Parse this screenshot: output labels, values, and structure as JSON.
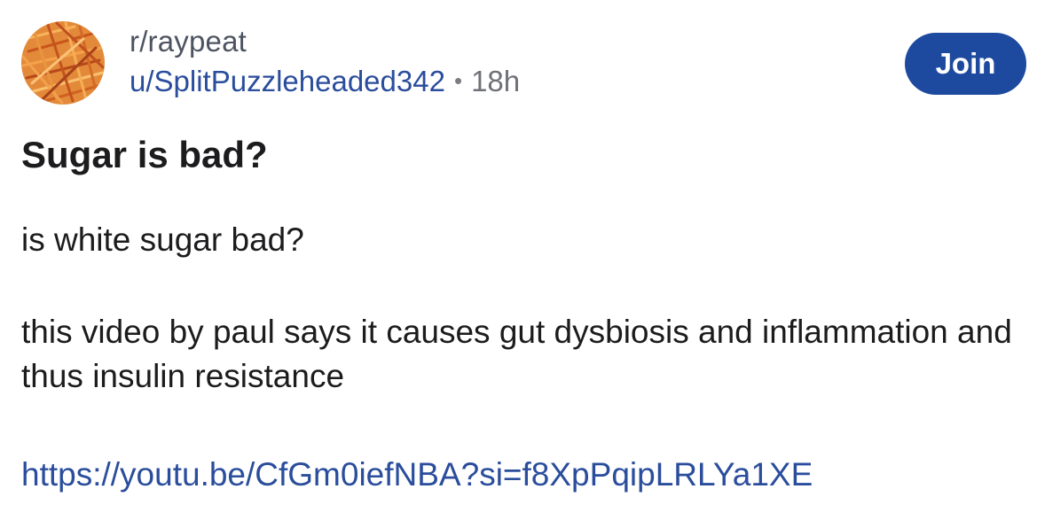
{
  "post": {
    "subreddit": "r/raypeat",
    "username": "u/SplitPuzzleheaded342",
    "separator": "•",
    "time": "18h",
    "join_label": "Join",
    "title": "Sugar is bad?",
    "body": [
      "is white sugar bad?",
      "this video by paul says it causes gut dysbiosis and inflammation and thus insulin resistance"
    ],
    "link": "https://youtu.be/CfGm0iefNBA?si=f8XpPqipLRLYa1XE"
  },
  "colors": {
    "join_button": "#1d4a9e",
    "link": "#2a4d9c",
    "avatar_base": "#d9782a"
  },
  "icons": {
    "avatar": "subreddit-avatar-icon"
  }
}
